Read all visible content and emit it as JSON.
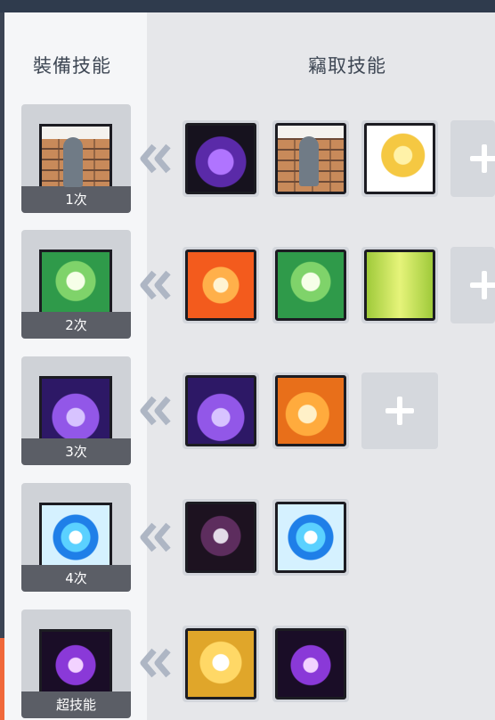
{
  "headers": {
    "equipped": "裝備技能",
    "stolen": "竊取技能"
  },
  "rows": [
    {
      "caption": "1次",
      "equipped_icon": "shadow-figure-brick-wall-icon",
      "stolen": [
        "purple-winged-blade-icon",
        "shadow-figure-brick-wall-icon",
        "golden-heroine-icon"
      ],
      "has_add": true
    },
    {
      "caption": "2次",
      "equipped_icon": "green-tree-spirit-icon",
      "stolen": [
        "orange-cross-sigil-icon",
        "green-tree-spirit-icon",
        "green-twin-spirits-icon"
      ],
      "has_add": true
    },
    {
      "caption": "3次",
      "equipped_icon": "violet-crystal-spire-icon",
      "stolen": [
        "violet-crystal-spire-icon",
        "orange-flame-burst-icon"
      ],
      "has_add": true
    },
    {
      "caption": "4次",
      "equipped_icon": "blue-orb-shield-icon",
      "stolen": [
        "dark-skull-scroll-icon",
        "blue-orb-shield-icon"
      ],
      "has_add": false
    },
    {
      "caption": "超技能",
      "equipped_icon": "violet-demon-aura-icon",
      "stolen": [
        "golden-guardian-icon",
        "violet-demon-aura-icon"
      ],
      "has_add": false
    }
  ],
  "colors": {
    "topbar": "#2f3b4d",
    "accent": "#f0683a",
    "caption_bg": "#5b5e66"
  }
}
